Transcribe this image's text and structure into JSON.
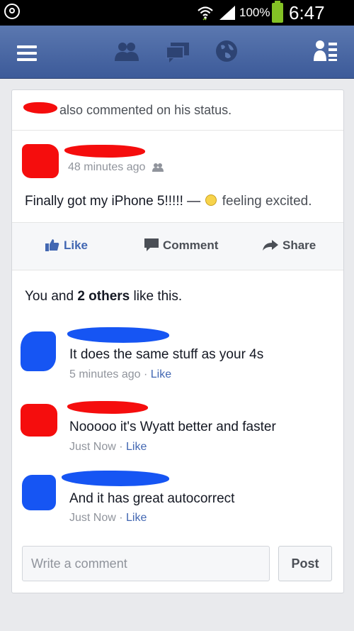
{
  "status_bar": {
    "battery_percent": "100%",
    "time": "6:47 PM",
    "battery_color": "#84c225"
  },
  "navbar": {
    "background": "#3c5a99",
    "icons": [
      "menu-icon",
      "friends-icon",
      "messages-icon",
      "globe-icon",
      "profile-icon"
    ]
  },
  "post": {
    "context_text": "also commented on his status.",
    "timestamp": "48 minutes ago",
    "body_text": "Finally got my iPhone 5!!!!! —",
    "feeling": "feeling excited.",
    "actions": {
      "like": "Like",
      "comment": "Comment",
      "share": "Share"
    },
    "likes": {
      "prefix": "You and",
      "others": "2 others",
      "suffix": "like this."
    }
  },
  "comments": [
    {
      "text": "It does the same stuff as your 4s",
      "time": "5 minutes ago",
      "like": "Like",
      "avatar_color": "blue"
    },
    {
      "text": "Nooooo it's Wyatt better and faster",
      "time": "Just Now",
      "like": "Like",
      "avatar_color": "red"
    },
    {
      "text": "And it has great autocorrect",
      "time": "Just Now",
      "like": "Like",
      "avatar_color": "blue"
    }
  ],
  "composer": {
    "placeholder": "Write a comment",
    "post_label": "Post"
  },
  "colors": {
    "link": "#4267b2",
    "redaction_red": "#f50d0d",
    "redaction_blue": "#1655f3"
  }
}
